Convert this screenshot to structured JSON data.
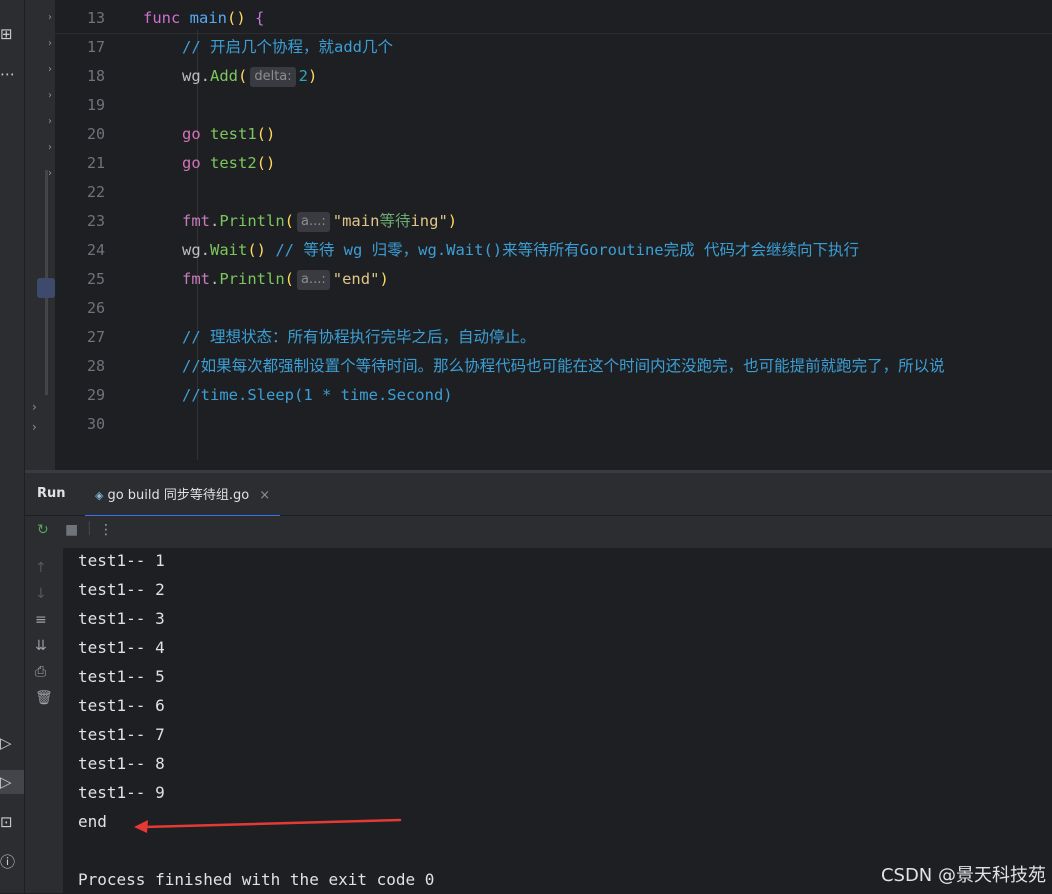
{
  "editor": {
    "lines": [
      {
        "num": "13",
        "tokens": [
          {
            "t": "func ",
            "c": "kw"
          },
          {
            "t": "main",
            "c": "fn"
          },
          {
            "t": "() ",
            "c": "paren"
          },
          {
            "t": "{",
            "c": "brace-p"
          }
        ],
        "indent": 0
      },
      {
        "num": "17",
        "tokens": [
          {
            "t": "// 开启几个协程，就",
            "c": "cmt"
          },
          {
            "t": "add",
            "c": "cmt b"
          },
          {
            "t": "几个",
            "c": "cmt"
          }
        ],
        "indent": 1
      },
      {
        "num": "18",
        "tokens": [
          {
            "t": "wg.",
            "c": ""
          },
          {
            "t": "Add",
            "c": "fname"
          },
          {
            "t": "(",
            "c": "paren"
          },
          {
            "t": "delta:",
            "c": "hint"
          },
          {
            "t": "2",
            "c": "num"
          },
          {
            "t": ")",
            "c": "paren"
          }
        ],
        "indent": 1
      },
      {
        "num": "19",
        "tokens": [],
        "indent": 1
      },
      {
        "num": "20",
        "tokens": [
          {
            "t": "go ",
            "c": "kw2"
          },
          {
            "t": "test1",
            "c": "fname"
          },
          {
            "t": "()",
            "c": "paren"
          }
        ],
        "indent": 1
      },
      {
        "num": "21",
        "tokens": [
          {
            "t": "go ",
            "c": "kw2"
          },
          {
            "t": "test2",
            "c": "fname"
          },
          {
            "t": "()",
            "c": "paren"
          }
        ],
        "indent": 1
      },
      {
        "num": "22",
        "tokens": [],
        "indent": 1
      },
      {
        "num": "23",
        "tokens": [
          {
            "t": "fmt",
            "c": "pkg"
          },
          {
            "t": ".",
            "c": ""
          },
          {
            "t": "Println",
            "c": "fname"
          },
          {
            "t": "(",
            "c": "paren"
          },
          {
            "t": "a...:",
            "c": "hint"
          },
          {
            "t": "\"main",
            "c": "strv"
          },
          {
            "t": "等待",
            "c": "str"
          },
          {
            "t": "ing\"",
            "c": "strv"
          },
          {
            "t": ")",
            "c": "paren"
          }
        ],
        "indent": 1
      },
      {
        "num": "24",
        "tokens": [
          {
            "t": "wg.",
            "c": ""
          },
          {
            "t": "Wait",
            "c": "fname"
          },
          {
            "t": "() ",
            "c": "paren"
          },
          {
            "t": "// 等待 wg 归零，wg.Wait()来等待所有Goroutine完成 代码才会继续向下执行",
            "c": "cmt"
          }
        ],
        "indent": 1
      },
      {
        "num": "25",
        "tokens": [
          {
            "t": "fmt",
            "c": "pkg"
          },
          {
            "t": ".",
            "c": ""
          },
          {
            "t": "Println",
            "c": "fname"
          },
          {
            "t": "(",
            "c": "paren"
          },
          {
            "t": "a...:",
            "c": "hint"
          },
          {
            "t": "\"end\"",
            "c": "strv"
          },
          {
            "t": ")",
            "c": "paren"
          }
        ],
        "indent": 1
      },
      {
        "num": "26",
        "tokens": [],
        "indent": 1
      },
      {
        "num": "27",
        "tokens": [
          {
            "t": "// 理想状态：所有协程执行完毕之后，自动停止。",
            "c": "cmt"
          }
        ],
        "indent": 1
      },
      {
        "num": "28",
        "tokens": [
          {
            "t": "//如果每次都强制设置个等待时间。那么协程代码也可能在这个时间内还没跑完，也可能提前就跑完了，所以说",
            "c": "cmt"
          }
        ],
        "indent": 1
      },
      {
        "num": "29",
        "tokens": [
          {
            "t": "//time.Sleep(1 * time.Second)",
            "c": "cmt"
          }
        ],
        "indent": 1
      },
      {
        "num": "30",
        "tokens": [],
        "indent": 1
      }
    ]
  },
  "run": {
    "label": "Run",
    "tab_title": "go build 同步等待组.go",
    "tab_close": "×"
  },
  "console": {
    "lines": [
      "test1-- 1",
      "test1-- 2",
      "test1-- 3",
      "test1-- 4",
      "test1-- 5",
      "test1-- 6",
      "test1-- 7",
      "test1-- 8",
      "test1-- 9",
      "end",
      "",
      "Process finished with the exit code 0"
    ]
  },
  "watermark": "CSDN @景天科技苑",
  "colors": {
    "annotation_arrow": "#e53935",
    "tab_underline": "#3574f0"
  }
}
